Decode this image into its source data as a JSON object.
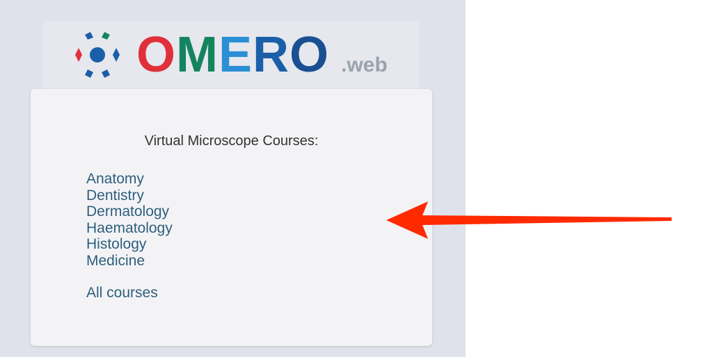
{
  "logo": {
    "letters": [
      {
        "char": "O",
        "color": "#e0303a"
      },
      {
        "char": "M",
        "color": "#14845f"
      },
      {
        "char": "E",
        "color": "#2a8fd4"
      },
      {
        "char": "R",
        "color": "#1b5fa8"
      },
      {
        "char": "O",
        "color": "#1a4f92"
      }
    ],
    "suffix": ".web",
    "icon": "omero-logo-icon"
  },
  "card": {
    "title": "Virtual Microscope Courses:",
    "courses": [
      "Anatomy",
      "Dentistry",
      "Dermatology",
      "Haematology",
      "Histology",
      "Medicine"
    ],
    "all_courses": "All courses"
  },
  "annotation": {
    "icon": "red-arrow-icon",
    "color": "#ff2a00"
  },
  "colors": {
    "panel_bg": "#dfe2ea",
    "card_bg": "#f3f3f6",
    "link": "#2e5f7c"
  }
}
